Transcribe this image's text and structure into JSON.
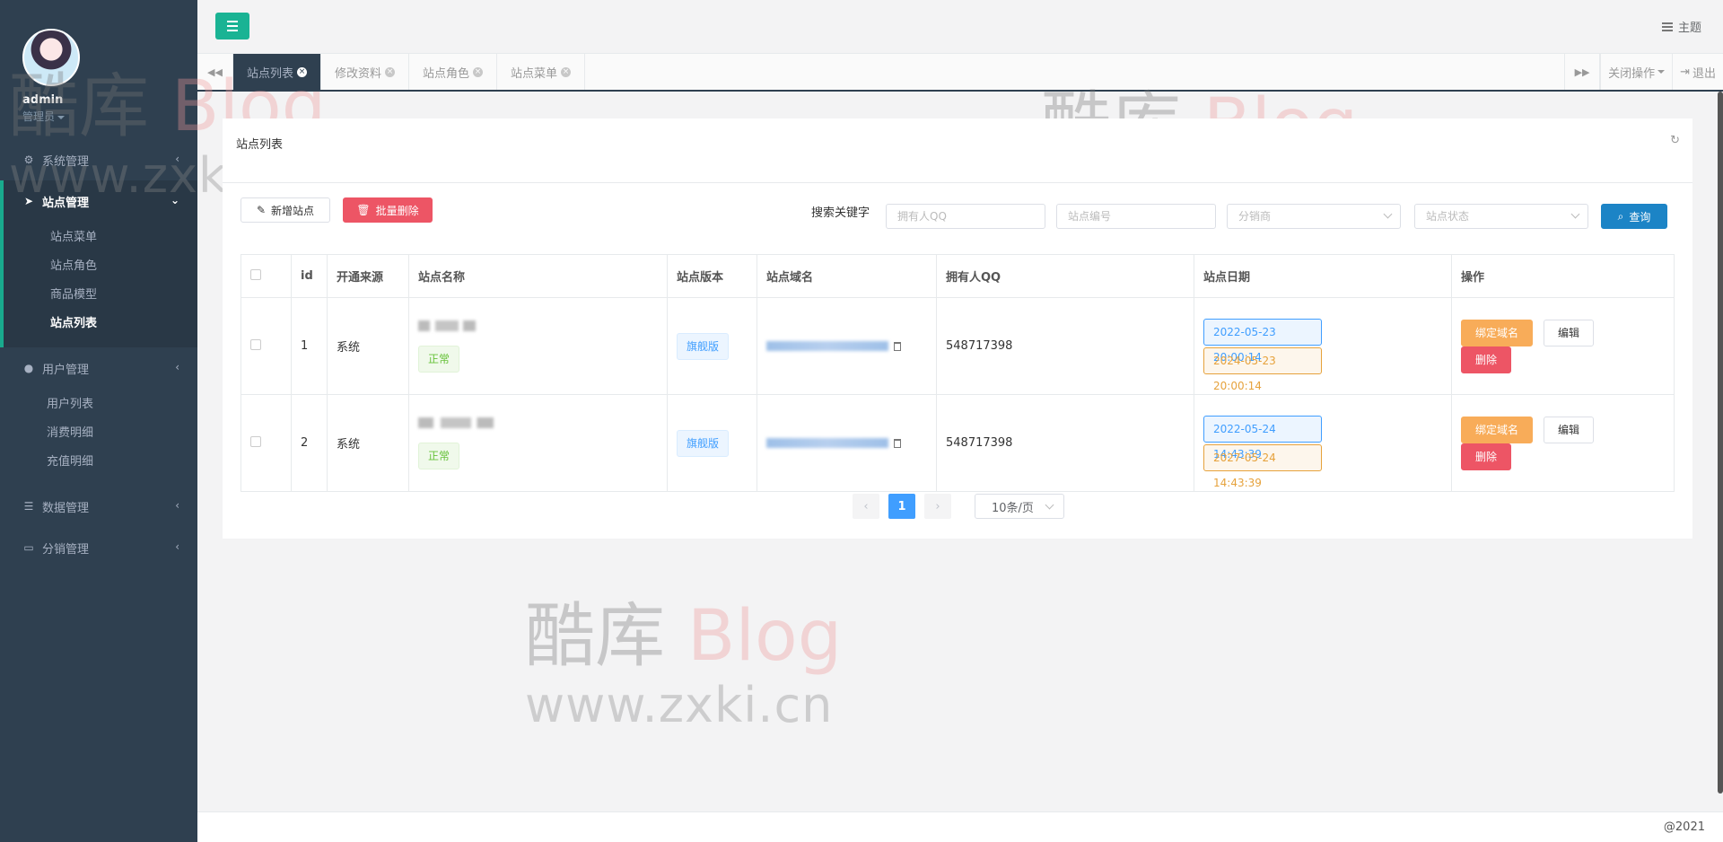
{
  "sidebar": {
    "profile": {
      "name": "admin",
      "role": "管理员"
    },
    "menu": [
      {
        "label": "系统管理",
        "icon": "gears-icon"
      },
      {
        "label": "站点管理",
        "icon": "paper-plane-icon",
        "active": true,
        "children": [
          "站点菜单",
          "站点角色",
          "商品模型",
          "站点列表"
        ],
        "current": "站点列表"
      },
      {
        "label": "用户管理",
        "icon": "user-icon",
        "children": [
          "用户列表",
          "消费明细",
          "充值明细"
        ]
      },
      {
        "label": "数据管理",
        "icon": "database-icon"
      },
      {
        "label": "分销管理",
        "icon": "desktop-icon"
      }
    ]
  },
  "topbar": {
    "theme_label": "主题"
  },
  "tabs": {
    "items": [
      "站点列表",
      "修改资料",
      "站点角色",
      "站点菜单"
    ],
    "active": "站点列表",
    "close_ops_label": "关闭操作",
    "logout_label": "退出"
  },
  "panel": {
    "title": "站点列表",
    "toolbar": {
      "add_label": "新增站点",
      "batch_delete_label": "批量删除",
      "search_label": "搜索关键字",
      "placeholders": {
        "owner_qq": "拥有人QQ",
        "site_id": "站点编号",
        "distributor": "分销商",
        "site_status": "站点状态"
      },
      "query_label": "查询"
    },
    "table": {
      "columns": [
        "id",
        "开通来源",
        "站点名称",
        "站点版本",
        "站点域名",
        "拥有人QQ",
        "站点日期",
        "操作"
      ],
      "rows": [
        {
          "id": "1",
          "source": "系统",
          "status": "正常",
          "version": "旗舰版",
          "owner_qq": "548717398",
          "start_date": "2022-05-23 20:00:14",
          "end_date": "2024-05-23 20:00:14"
        },
        {
          "id": "2",
          "source": "系统",
          "status": "正常",
          "version": "旗舰版",
          "owner_qq": "548717398",
          "start_date": "2022-05-24 14:43:39",
          "end_date": "2027-05-24 14:43:39"
        }
      ],
      "actions": {
        "bind": "绑定域名",
        "edit": "编辑",
        "delete": "删除"
      }
    },
    "pagination": {
      "current": "1",
      "page_size": "10条/页"
    }
  },
  "footer": {
    "copyright": "@2021"
  },
  "watermark": {
    "text_cn": "酷库",
    "text_en": "Blog",
    "url": "www.zxki.cn"
  },
  "colors": {
    "sidebar": "#2f4050",
    "accent": "#1ab394",
    "danger": "#ed5565",
    "warning": "#f8ac59",
    "primary": "#1c84c6"
  }
}
